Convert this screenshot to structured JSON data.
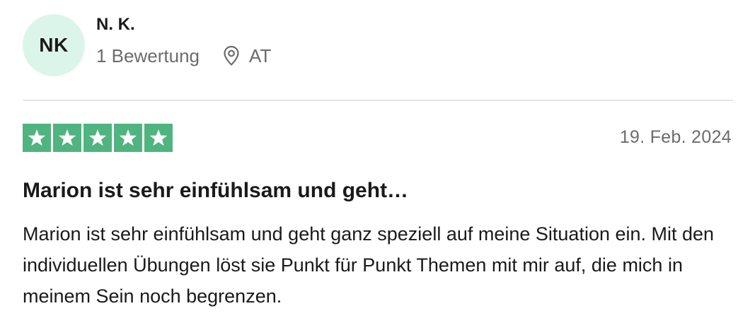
{
  "reviewer": {
    "initials": "NK",
    "name": "N. K.",
    "review_count": "1 Bewertung",
    "location": "AT",
    "avatar_color": "#dcf5ea"
  },
  "review": {
    "rating": 5,
    "rating_max": 5,
    "star_color": "#50b480",
    "date": "19. Feb. 2024",
    "title": "Marion ist sehr einfühlsam und geht…",
    "text": "Marion ist sehr einfühlsam und geht ganz speziell auf meine Situation ein. Mit den individuellen Übungen löst sie Punkt für Punkt Themen mit mir auf, die mich in meinem Sein noch begrenzen."
  },
  "icons": {
    "location": "location-pin-icon",
    "star": "star-icon"
  }
}
